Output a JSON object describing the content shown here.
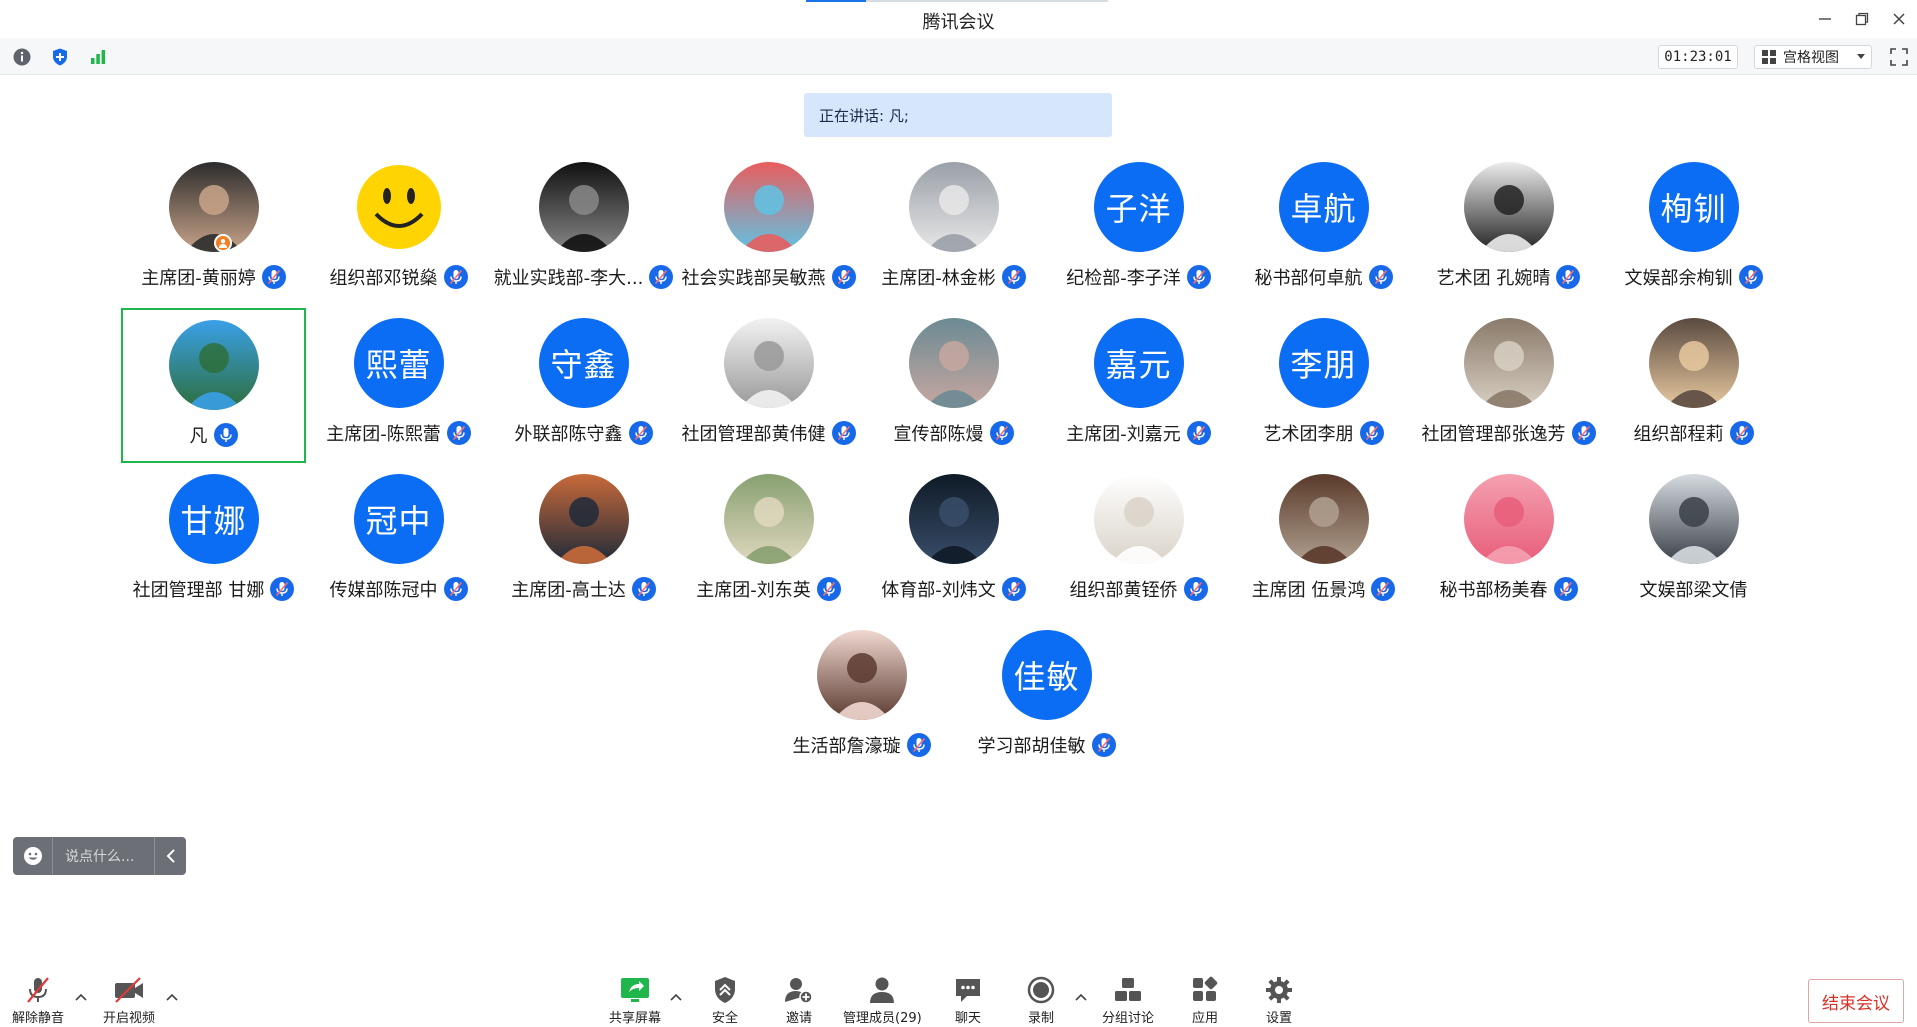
{
  "window": {
    "title": "腾讯会议"
  },
  "toolbar": {
    "info_icon": "info-icon",
    "security_icon": "shield-icon",
    "signal_icon": "signal-icon",
    "timer": "01:23:01",
    "view_label": "宫格视图"
  },
  "speaking": {
    "label": "正在讲话: 凡;"
  },
  "participants": [
    {
      "name": "主席团-黄丽婷",
      "avatar_type": "photo",
      "host": true,
      "mic_muted": true
    },
    {
      "name": "组织部邓锐燊",
      "avatar_type": "smiley",
      "mic_muted": true
    },
    {
      "name": "就业实践部-李大...",
      "avatar_type": "photo",
      "mic_muted": true
    },
    {
      "name": "社会实践部吴敏燕",
      "avatar_type": "photo",
      "mic_muted": true
    },
    {
      "name": "主席团-林金彬",
      "avatar_type": "photo",
      "mic_muted": true
    },
    {
      "name": "纪检部-李子洋",
      "avatar_text": "子洋",
      "mic_muted": true
    },
    {
      "name": "秘书部何卓航",
      "avatar_text": "卓航",
      "mic_muted": true
    },
    {
      "name": "艺术团 孔婉晴",
      "avatar_type": "photo",
      "mic_muted": true
    },
    {
      "name": "文娱部余栒钏",
      "avatar_text": "栒钏",
      "mic_muted": true
    },
    {
      "name": "凡",
      "avatar_type": "photo",
      "mic_muted": false,
      "active": true
    },
    {
      "name": "主席团-陈熙蕾",
      "avatar_text": "熙蕾",
      "mic_muted": true
    },
    {
      "name": "外联部陈守鑫",
      "avatar_text": "守鑫",
      "mic_muted": true
    },
    {
      "name": "社团管理部黄伟健",
      "avatar_type": "photo",
      "mic_muted": true
    },
    {
      "name": "宣传部陈熳",
      "avatar_type": "photo",
      "mic_muted": true
    },
    {
      "name": "主席团-刘嘉元",
      "avatar_text": "嘉元",
      "mic_muted": true
    },
    {
      "name": "艺术团李朋",
      "avatar_text": "李朋",
      "mic_muted": true
    },
    {
      "name": "社团管理部张逸芳",
      "avatar_type": "photo",
      "mic_muted": true
    },
    {
      "name": "组织部程莉",
      "avatar_type": "photo",
      "mic_muted": true
    },
    {
      "name": "社团管理部 甘娜",
      "avatar_text": "甘娜",
      "mic_muted": true
    },
    {
      "name": "传媒部陈冠中",
      "avatar_text": "冠中",
      "mic_muted": true
    },
    {
      "name": "主席团-高士达",
      "avatar_type": "photo",
      "mic_muted": true
    },
    {
      "name": "主席团-刘东英",
      "avatar_type": "photo",
      "mic_muted": true
    },
    {
      "name": "体育部-刘炜文",
      "avatar_type": "photo",
      "mic_muted": true
    },
    {
      "name": "组织部黄铚侨",
      "avatar_type": "photo",
      "mic_muted": true
    },
    {
      "name": "主席团 伍景鸿",
      "avatar_type": "photo",
      "mic_muted": true
    },
    {
      "name": "秘书部杨美春",
      "avatar_type": "photo",
      "mic_muted": true
    },
    {
      "name": "文娱部梁文倩",
      "avatar_type": "photo",
      "no_mic": true
    },
    {
      "name": "生活部詹濠璇",
      "avatar_type": "photo",
      "mic_muted": true
    },
    {
      "name": "学习部胡佳敏",
      "avatar_text": "佳敏",
      "mic_muted": true
    }
  ],
  "chat": {
    "placeholder": "说点什么..."
  },
  "bottombar": {
    "unmute": "解除静音",
    "start_video": "开启视频",
    "share_screen": "共享屏幕",
    "security": "安全",
    "invite": "邀请",
    "manage_members": "管理成员(29)",
    "chat": "聊天",
    "record": "录制",
    "breakout": "分组讨论",
    "apps": "应用",
    "settings": "设置",
    "end_meeting": "结束会议"
  },
  "colors": {
    "accent": "#0b6cf4",
    "mic": "#1769e9",
    "active_border": "#1fb64c",
    "end": "#d93025"
  }
}
